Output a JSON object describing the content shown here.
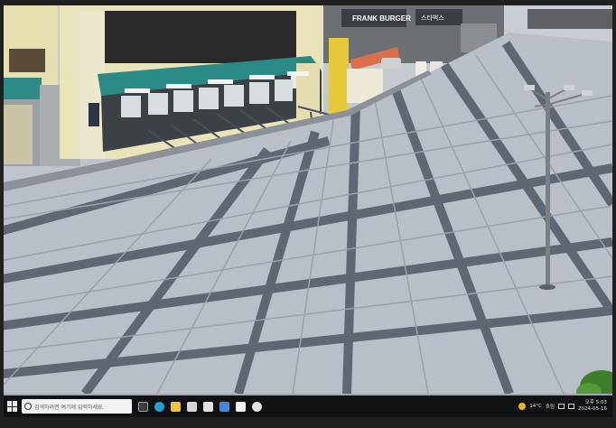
{
  "scene": {
    "shop_signs": [
      "FRANK BURGER",
      "스타벅스"
    ],
    "building_color": "#e8e3b8",
    "awning_color": "#2a8a86",
    "plaza_light": "#b9bfc6",
    "plaza_dark": "#5f6773"
  },
  "taskbar": {
    "search_placeholder": "검색하려면 여기에 입력하세요.",
    "pinned_icons": [
      "task-view-icon",
      "edge-icon",
      "file-explorer-icon",
      "store-icon",
      "mail-icon",
      "app-icon",
      "security-icon",
      "chrome-icon"
    ],
    "weather_temp": "14°C",
    "weather_desc": "흐림",
    "time": "오후 5:03",
    "date": "2024-05-16"
  }
}
